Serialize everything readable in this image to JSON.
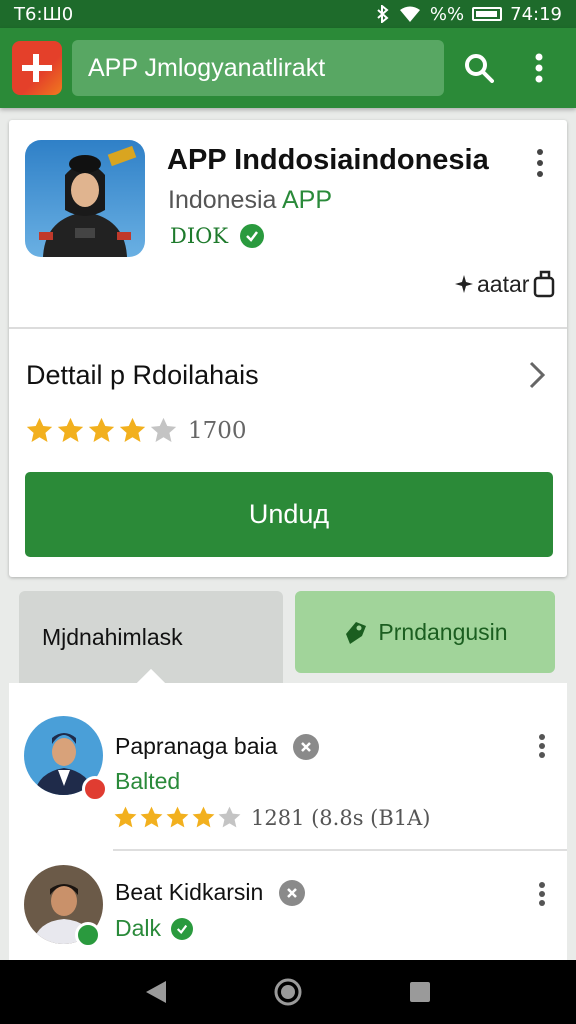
{
  "status_bar": {
    "left_text": "T6:Ш0",
    "signal": "%%",
    "time": "74:19"
  },
  "app_bar": {
    "search_text": "APP Jmlogyanatlirakt"
  },
  "app": {
    "title": "APP Inddosiaindonesia",
    "subtitle_prefix": "Indonesia ",
    "subtitle_accent": "APP",
    "tag": "DIOK",
    "action_label": "aatar"
  },
  "details": {
    "title": "Dettail p Rdoilahais",
    "rating": 4,
    "rating_count": "1700",
    "install_label": "Unduд"
  },
  "tabs": {
    "left_label": "Mjdnahimlask",
    "right_label": "Prndangusin"
  },
  "list": {
    "items": [
      {
        "name": "Papranaga baia",
        "status": "Balted",
        "rating": 4,
        "meta": "1281 (8.8s (B1A)"
      },
      {
        "name": "Beat Kidkarsin",
        "status": "Dalk"
      }
    ]
  },
  "colors": {
    "primary": "#2b8a38",
    "status_bar": "#1e6b2b",
    "tab_active": "#a1d49a",
    "star": "#f2b01e"
  }
}
